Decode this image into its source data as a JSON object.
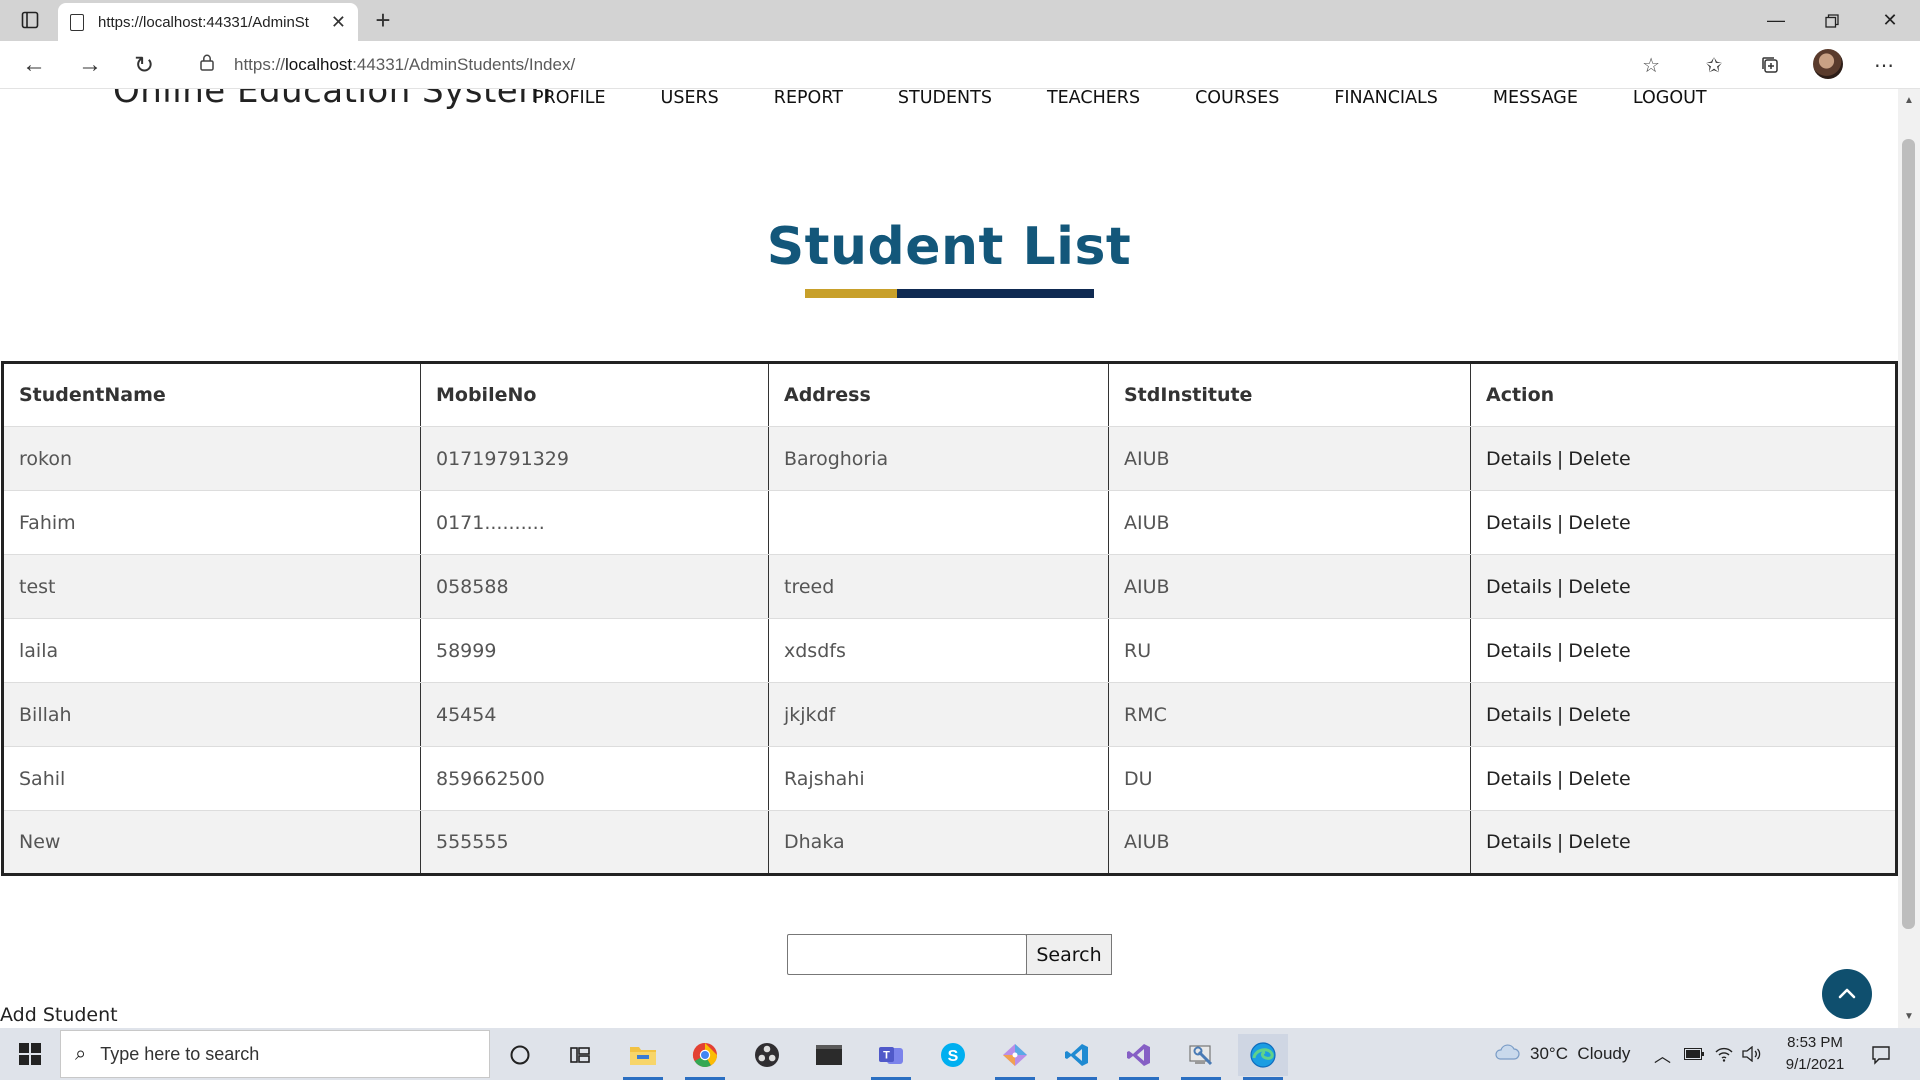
{
  "browser": {
    "tab_title": "https://localhost:44331/AdminSt",
    "url_prefix": "https://",
    "url_host": "localhost",
    "url_rest": ":44331/AdminStudents/Index/"
  },
  "site": {
    "brand": "Online Education System",
    "nav": [
      "PROFILE",
      "USERS",
      "REPORT",
      "STUDENTS",
      "TEACHERS",
      "COURSES",
      "FINANCIALS",
      "MESSAGE",
      "LOGOUT"
    ]
  },
  "page": {
    "heading": "Student List",
    "accent_gold": "#c8a02a",
    "accent_navy": "#0f2a52",
    "heading_color": "#13577a"
  },
  "table": {
    "headers": [
      "StudentName",
      "MobileNo",
      "Address",
      "StdInstitute",
      "Action"
    ],
    "rows": [
      {
        "name": "rokon",
        "mobile": "01719791329",
        "address": "Baroghoria",
        "institute": "AIUB"
      },
      {
        "name": "Fahim",
        "mobile": "0171..........",
        "address": "",
        "institute": "AIUB"
      },
      {
        "name": "test",
        "mobile": "058588",
        "address": "treed",
        "institute": "AIUB"
      },
      {
        "name": "laila",
        "mobile": "58999",
        "address": "xdsdfs",
        "institute": "RU"
      },
      {
        "name": "Billah",
        "mobile": "45454",
        "address": "jkjkdf",
        "institute": "RMC"
      },
      {
        "name": "Sahil",
        "mobile": "859662500",
        "address": "Rajshahi",
        "institute": "DU"
      },
      {
        "name": "New",
        "mobile": "555555",
        "address": "Dhaka",
        "institute": "AIUB"
      }
    ],
    "details_label": "Details",
    "separator": "|",
    "delete_label": "Delete"
  },
  "search": {
    "value": "",
    "button_label": "Search"
  },
  "add_student_label": "Add Student",
  "taskbar": {
    "search_placeholder": "Type here to search",
    "weather": "30°C  Cloudy",
    "time": "8:53 PM",
    "date": "9/1/2021"
  }
}
